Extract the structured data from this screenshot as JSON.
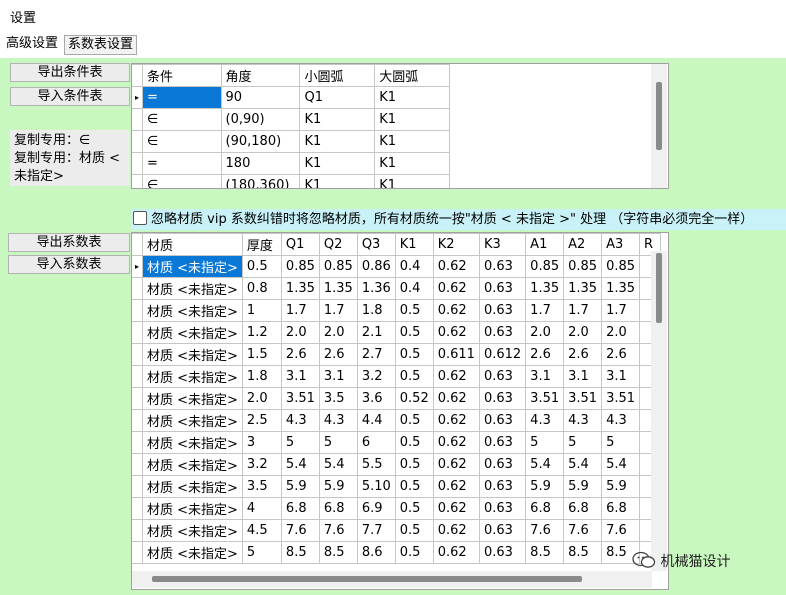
{
  "window": {
    "title": "设置"
  },
  "tabs": [
    {
      "label": "高级设置"
    },
    {
      "label": "系数表设置"
    }
  ],
  "condition": {
    "export_label": "导出条件表",
    "import_label": "导入条件表",
    "copy_lines": [
      "复制专用：∈",
      "复制专用：材质 <",
      "未指定>"
    ],
    "columns": [
      "条件",
      "角度",
      "小圆弧",
      "大圆弧"
    ],
    "rows": [
      [
        "=",
        "90",
        "Q1",
        "K1"
      ],
      [
        "∈",
        "(0,90)",
        "K1",
        "K1"
      ],
      [
        "∈",
        "(90,180)",
        "K1",
        "K1"
      ],
      [
        "=",
        "180",
        "K1",
        "K1"
      ],
      [
        "∈",
        "(180,360)",
        "K1",
        "K1"
      ]
    ]
  },
  "ignore_checkbox": {
    "label": "忽略材质 vip 系数纠错时将忽略材质，所有材质统一按\"材质 < 未指定 >\" 处理 （字符串必须完全一样）",
    "checked": false
  },
  "coefficient": {
    "export_label": "导出系数表",
    "import_label": "导入系数表",
    "columns": [
      "材质",
      "厚度",
      "Q1",
      "Q2",
      "Q3",
      "K1",
      "K2",
      "K3",
      "A1",
      "A2",
      "A3",
      "R"
    ],
    "rows": [
      [
        "材质 <未指定>",
        "0.5",
        "0.85",
        "0.85",
        "0.86",
        "0.4",
        "0.62",
        "0.63",
        "0.85",
        "0.85",
        "0.85",
        ""
      ],
      [
        "材质 <未指定>",
        "0.8",
        "1.35",
        "1.35",
        "1.36",
        "0.4",
        "0.62",
        "0.63",
        "1.35",
        "1.35",
        "1.35",
        ""
      ],
      [
        "材质 <未指定>",
        "1",
        "1.7",
        "1.7",
        "1.8",
        "0.5",
        "0.62",
        "0.63",
        "1.7",
        "1.7",
        "1.7",
        ""
      ],
      [
        "材质 <未指定>",
        "1.2",
        "2.0",
        "2.0",
        "2.1",
        "0.5",
        "0.62",
        "0.63",
        "2.0",
        "2.0",
        "2.0",
        ""
      ],
      [
        "材质 <未指定>",
        "1.5",
        "2.6",
        "2.6",
        "2.7",
        "0.5",
        "0.611",
        "0.612",
        "2.6",
        "2.6",
        "2.6",
        ""
      ],
      [
        "材质 <未指定>",
        "1.8",
        "3.1",
        "3.1",
        "3.2",
        "0.5",
        "0.62",
        "0.63",
        "3.1",
        "3.1",
        "3.1",
        ""
      ],
      [
        "材质 <未指定>",
        "2.0",
        "3.51",
        "3.5",
        "3.6",
        "0.52",
        "0.62",
        "0.63",
        "3.51",
        "3.51",
        "3.51",
        ""
      ],
      [
        "材质 <未指定>",
        "2.5",
        "4.3",
        "4.3",
        "4.4",
        "0.5",
        "0.62",
        "0.63",
        "4.3",
        "4.3",
        "4.3",
        ""
      ],
      [
        "材质 <未指定>",
        "3",
        "5",
        "5",
        "6",
        "0.5",
        "0.62",
        "0.63",
        "5",
        "5",
        "5",
        ""
      ],
      [
        "材质 <未指定>",
        "3.2",
        "5.4",
        "5.4",
        "5.5",
        "0.5",
        "0.62",
        "0.63",
        "5.4",
        "5.4",
        "5.4",
        ""
      ],
      [
        "材质 <未指定>",
        "3.5",
        "5.9",
        "5.9",
        "5.10",
        "0.5",
        "0.62",
        "0.63",
        "5.9",
        "5.9",
        "5.9",
        ""
      ],
      [
        "材质 <未指定>",
        "4",
        "6.8",
        "6.8",
        "6.9",
        "0.5",
        "0.62",
        "0.63",
        "6.8",
        "6.8",
        "6.8",
        ""
      ],
      [
        "材质 <未指定>",
        "4.5",
        "7.6",
        "7.6",
        "7.7",
        "0.5",
        "0.62",
        "0.63",
        "7.6",
        "7.6",
        "7.6",
        ""
      ],
      [
        "材质 <未指定>",
        "5",
        "8.5",
        "8.5",
        "8.6",
        "0.5",
        "0.62",
        "0.63",
        "8.5",
        "8.5",
        "8.5",
        ""
      ]
    ]
  },
  "watermark": {
    "icon": "wechat-icon",
    "text": "机械猫设计"
  },
  "colors": {
    "background": "#c9f7c0",
    "selected": "#0a78d7",
    "checkbox_row": "#c8f2f8"
  }
}
